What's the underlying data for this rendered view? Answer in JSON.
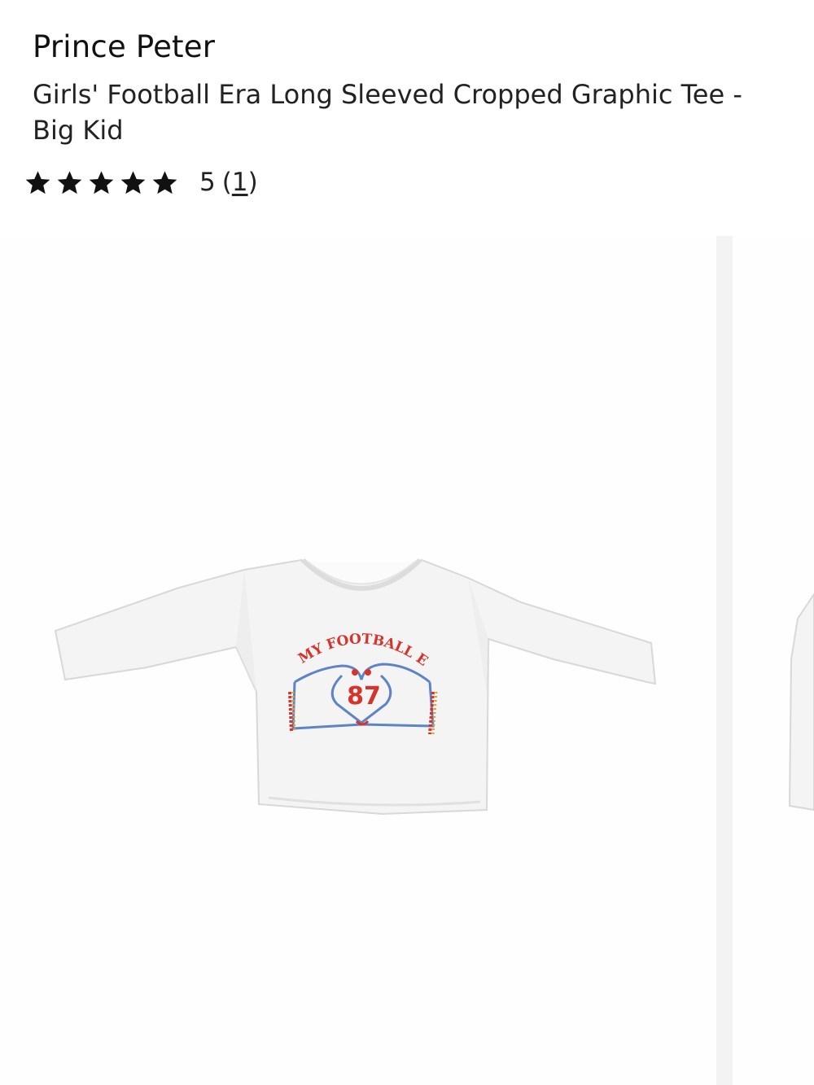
{
  "product": {
    "brand": "Prince Peter",
    "name": "Girls' Football Era Long Sleeved Cropped Graphic Tee - Big Kid"
  },
  "rating": {
    "value": "5",
    "count_open": "(",
    "count": "1",
    "count_close": ")",
    "stars_filled": 5,
    "stars_total": 5
  },
  "graphic": {
    "slogan": "IN MY FOOTBALL ERA",
    "number": "87"
  },
  "colors": {
    "shirt": "#f4f4f4",
    "print_red": "#d6342a",
    "print_blue": "#5e84c4",
    "print_gold": "#e0a02a"
  }
}
